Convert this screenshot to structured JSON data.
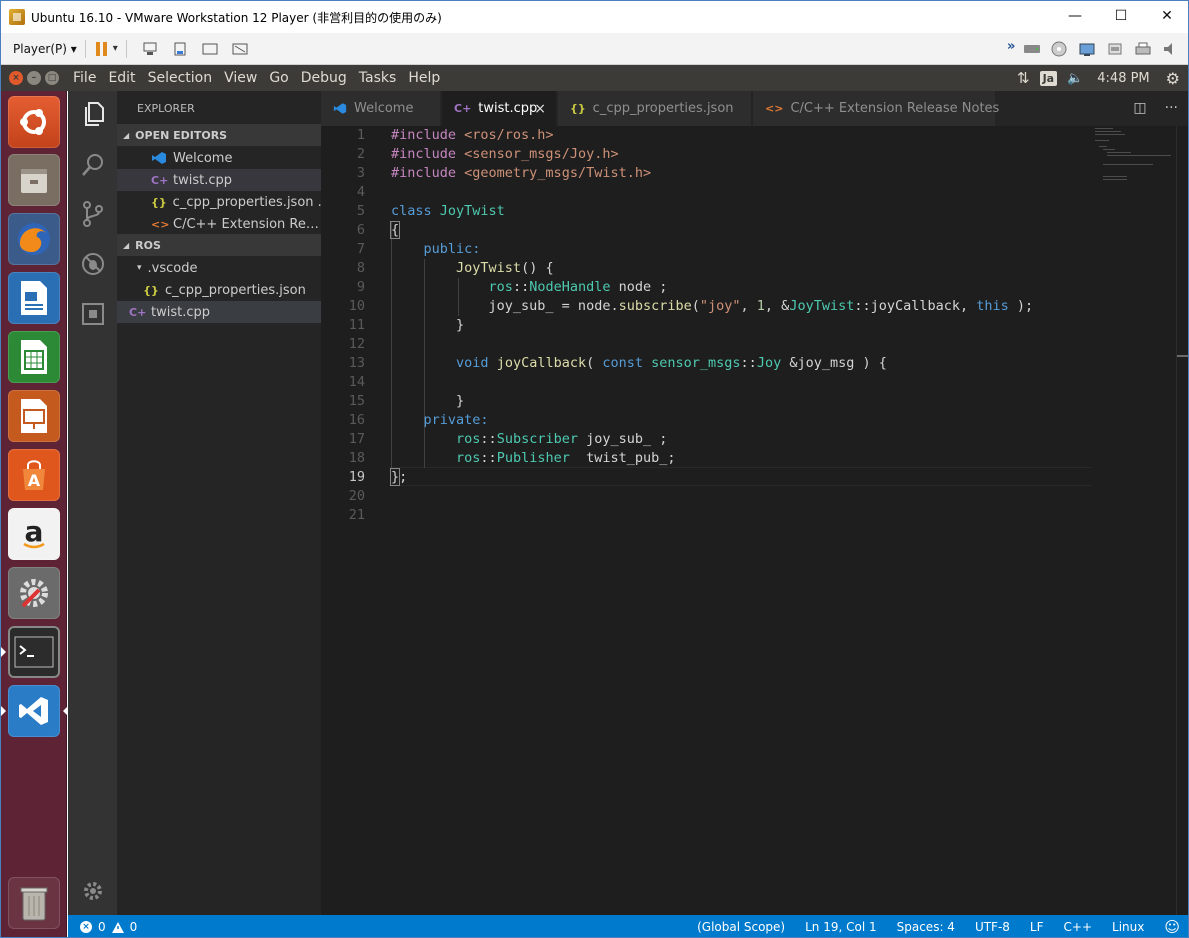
{
  "window": {
    "title": "Ubuntu 16.10 - VMware Workstation 12 Player (非営利目的の使用のみ)",
    "minimize": "—",
    "maximize": "☐",
    "close": "✕"
  },
  "vmware_toolbar": {
    "player_menu": "Player(P) ▾",
    "dropdown": "▾",
    "more": "»"
  },
  "ubuntu_panel": {
    "menu": [
      "File",
      "Edit",
      "Selection",
      "View",
      "Go",
      "Debug",
      "Tasks",
      "Help"
    ],
    "keyboard_lang": "Ja",
    "time": "4:48 PM",
    "network_icon": "⇅",
    "volume_icon": "🔈",
    "settings_icon": "⚙"
  },
  "launcher": {
    "items": [
      "ubuntu-logo",
      "files",
      "firefox",
      "libreoffice-writer",
      "libreoffice-calc",
      "libreoffice-impress",
      "software-center",
      "amazon",
      "system-settings",
      "terminal",
      "vscode",
      "trash"
    ]
  },
  "sidebar": {
    "title": "EXPLORER",
    "open_editors_header": "OPEN EDITORS",
    "open_editors": [
      {
        "icon": "vscode-icon",
        "label": "Welcome"
      },
      {
        "icon": "cpp-icon",
        "label": "twist.cpp"
      },
      {
        "icon": "json-icon",
        "label": "c_cpp_properties.json  .vscode"
      },
      {
        "icon": "notes-icon",
        "label": "C/C++ Extension Release Notes"
      }
    ],
    "ros_header": "ROS",
    "ros_items": [
      {
        "label": ".vscode"
      },
      {
        "label": "c_cpp_properties.json"
      },
      {
        "label": "twist.cpp"
      }
    ],
    "caret_open": "◢",
    "caret_folder": "▾",
    "json_glyph": "{}",
    "cpp_glyph": "C+",
    "notes_glyph": "<>",
    "vscode_glyph": "⟩"
  },
  "tabs": [
    {
      "label": "Welcome",
      "icon": "vscode-icon"
    },
    {
      "label": "twist.cpp",
      "icon": "cpp-icon",
      "active": true
    },
    {
      "label": "c_cpp_properties.json",
      "icon": "json-icon"
    },
    {
      "label": "C/C++ Extension Release Notes",
      "icon": "notes-icon"
    }
  ],
  "tab_close": "×",
  "editor_actions": {
    "split": "◫",
    "more": "···"
  },
  "editor": {
    "line_numbers": [
      "1",
      "2",
      "3",
      "4",
      "5",
      "6",
      "7",
      "8",
      "9",
      "10",
      "11",
      "12",
      "13",
      "14",
      "15",
      "16",
      "17",
      "18",
      "19",
      "20",
      "21"
    ],
    "lines": [
      "#include <ros/ros.h>",
      "#include <sensor_msgs/Joy.h>",
      "#include <geometry_msgs/Twist.h>",
      "",
      "class JoyTwist",
      "{",
      "    public:",
      "        JoyTwist() {",
      "            ros::NodeHandle node ;",
      "            joy_sub_ = node.subscribe(\"joy\", 1, &JoyTwist::joyCallback, this );",
      "        }",
      "",
      "        void joyCallback( const sensor_msgs::Joy &joy_msg ) {",
      "",
      "        }",
      "    private:",
      "        ros::Subscriber joy_sub_ ;",
      "        ros::Publisher  twist_pub_;",
      "};",
      "",
      ""
    ]
  },
  "colors": {
    "status_bar": "#007acc",
    "editor_bg": "#1e1e1e",
    "sidebar_bg": "#252526",
    "activity_bg": "#333333",
    "launcher_bg": "#5e2435",
    "keyword": "#569cd6",
    "string": "#ce9178",
    "type": "#4ec9b0",
    "function": "#dcdcaa",
    "preproc": "#c586c0"
  },
  "statusbar": {
    "errors": "0",
    "warnings": "0",
    "scope": "(Global Scope)",
    "position": "Ln 19, Col 1",
    "indent": "Spaces: 4",
    "encoding": "UTF-8",
    "eol": "LF",
    "language": "C++",
    "os": "Linux",
    "feedback_icon": "☺"
  }
}
